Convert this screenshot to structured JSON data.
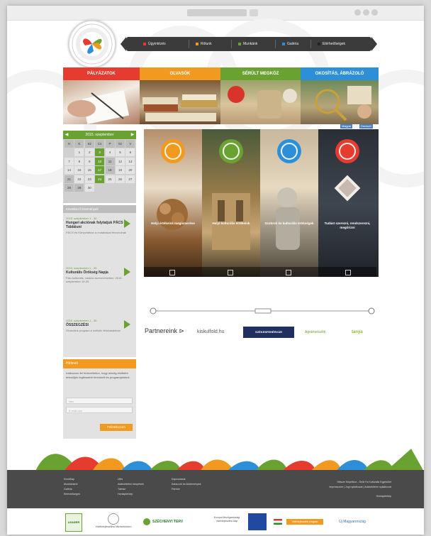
{
  "nav": {
    "items": [
      {
        "label": "Ügyintézés",
        "color": "#e63c2f"
      },
      {
        "label": "Rólunk",
        "color": "#f29a1f"
      },
      {
        "label": "Munkánk",
        "color": "#6aa232"
      },
      {
        "label": "Galéria",
        "color": "#2d8fd8"
      },
      {
        "label": "Elérhetőségek",
        "color": "#222222"
      }
    ]
  },
  "categories": [
    {
      "label": "PÁLYÁZATOK",
      "color": "#e63c2f"
    },
    {
      "label": "OLVASÓK",
      "color": "#f29a1f"
    },
    {
      "label": "SÉRÜLT MEGKÖZ",
      "color": "#6aa232"
    },
    {
      "label": "OKOSÍTÁS, ÁBRÁZOLÓ",
      "color": "#2d8fd8"
    }
  ],
  "calendar": {
    "title": "2015. szeptember",
    "prev": "◀",
    "next": "▶",
    "weekdays": [
      "H",
      "K",
      "Sz",
      "Cs",
      "P",
      "Sz",
      "V"
    ],
    "days": [
      "",
      "1",
      "2",
      "3",
      "4",
      "5",
      "6",
      "7",
      "8",
      "9",
      "10",
      "11",
      "12",
      "13",
      "14",
      "15",
      "16",
      "17",
      "18",
      "19",
      "20",
      "21",
      "22",
      "23",
      "24",
      "25",
      "26",
      "27",
      "28",
      "29",
      "30",
      "",
      "",
      "",
      ""
    ],
    "highlight": [
      "3",
      "10",
      "11",
      "17",
      "18",
      "21",
      "24",
      "28",
      "29"
    ],
    "green": [
      "3",
      "10",
      "17",
      "24"
    ]
  },
  "events": {
    "header": "Következő Események",
    "items": [
      {
        "date": "2015. szeptember 1 - 30.",
        "title": "Hungari akciónak folytatjuk PÁCS Tábláiuni",
        "text": "PÁCS és Könyvtárban a mutatóskal felvonulnak"
      },
      {
        "date": "2015. szeptember 1 - 30.",
        "title": "Kulturális Örökség Napja",
        "text": "Falu kulturális, vaskos szervezésében. 2015 - szeptember 19-20."
      },
      {
        "date": "2015. szeptember 1 - 30.",
        "title": "ÖSSZEGZÉSI",
        "text": "Olvasóink program a szélsőc felolvasásban"
      }
    ]
  },
  "newsletter": {
    "header": "Hírlevél",
    "text": "Iratkozzon fel hírlevelünkre, hogy mindig elsőként értesüljön legfrissebb híreinkről és programjainkról.",
    "name_placeholder": "Név",
    "email_placeholder": "E-mail cím",
    "button": "Feliratkozom"
  },
  "lang": [
    "Magyar",
    "Deutsch"
  ],
  "panels": [
    {
      "title": "Helyi értékeink megismerése",
      "icon_color": "#f29a1f"
    },
    {
      "title": "Helyi kulturális értékeink",
      "icon_color": "#6aa232"
    },
    {
      "title": "Szobrok és kulturális örökségek",
      "icon_color": "#2d8fd8"
    },
    {
      "title": "Tudást szerezni, rendszerezni, megőrizni",
      "icon_color": "#e63c2f"
    }
  ],
  "partners": {
    "label": "Partnereink",
    "logos": [
      "kiskulfold.hu",
      "SZÉKESFEHÉRVÁR",
      "Agrárturisztik",
      "tanya"
    ]
  },
  "footer": {
    "col1": [
      "Kezdőlap",
      "Munkáinkról",
      "Galéria",
      "Elérhetőségek"
    ],
    "col2": [
      "Ülés",
      "Adatvédelmi irányelvek",
      "Tárház",
      "Honlaptérkép"
    ],
    "col3": [
      "Kapcsolatok",
      "Kalauzok és közlemények",
      "Partner"
    ],
    "right": [
      "Hőszer Kispelkoz - Örök Fa Kulturális Egyesület",
      "Impresszum | Jogi nyilatkozat | Adatvédelmi nyilatkozat",
      "Honlaptérkép"
    ]
  },
  "sponsors": [
    "LEADER",
    "Vidékfejlesztési Minisztérium",
    "SZÉCHENYI TERV",
    "Európai Mezőgazdasági Vidékfejlesztési Alap",
    "Vidékfejlesztési program",
    "Új Magyarország"
  ]
}
